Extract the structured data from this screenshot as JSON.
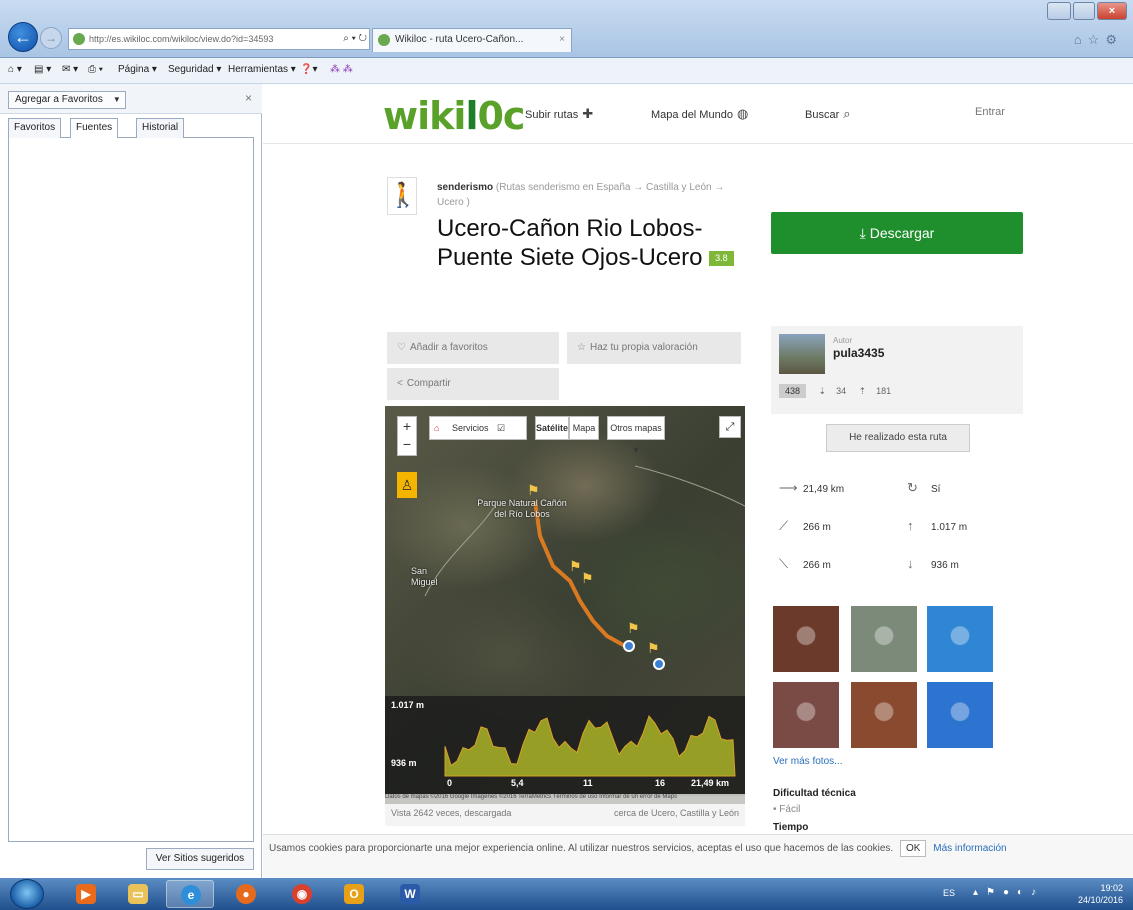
{
  "browser": {
    "url": "http://es.wikiloc.com/wikiloc/view.do?id=34593",
    "tab_title": "Wikiloc - ruta Ucero-Cañon...",
    "menu": [
      "Página ▾",
      "Seguridad ▾",
      "Herramientas ▾"
    ]
  },
  "favorites": {
    "add_label": "Agregar a Favoritos",
    "tabs": [
      "Favoritos",
      "Fuentes",
      "Historial"
    ],
    "suggested_label": "Ver Sitios sugeridos"
  },
  "site": {
    "logo_a": "wiki",
    "logo_b": "l",
    "logo_c": "0c",
    "nav": {
      "upload": "Subir rutas",
      "world_map": "Mapa del Mundo",
      "search": "Buscar",
      "login": "Entrar"
    }
  },
  "route": {
    "activity": "senderismo",
    "breadcrumb": "(Rutas senderismo en España → Castilla y León → Ucero )",
    "title": "Ucero-Cañon Rio Lobos-Puente Siete Ojos-Ucero",
    "badge": "3.8",
    "download": "Descargar",
    "actions": {
      "favorite": "Añadir a favoritos",
      "rate": "Haz tu propia valoración",
      "share": "Compartir"
    }
  },
  "map": {
    "zoom_in": "+",
    "zoom_out": "−",
    "services": "Servicios",
    "satellite": "Satélite",
    "map_type": "Mapa",
    "other_maps": "Otros mapas ▾",
    "place_1": "Parque Natural Cañón del Río Lobos",
    "place_2": "San Miguel",
    "elev_max": "1.017 m",
    "elev_min": "936 m",
    "x_ticks": [
      "0",
      "5,4",
      "11",
      "16",
      "21,49 km"
    ],
    "attribution": "Datos de mapas ©2016 Google Imágenes ©2016 TerraMetrics Términos de uso Informar de un error de Maps",
    "footer_left": "Vista 2642 veces, descargada",
    "footer_right": "cerca de Ucero, Castilla y León"
  },
  "author": {
    "label": "Autor",
    "name": "pula3435",
    "routes": "438",
    "followers": "34",
    "following": "181",
    "done_button": "He realizado esta ruta"
  },
  "stats": {
    "distance": "21,49 km",
    "loop": "Sí",
    "up": "266 m",
    "max_alt": "1.017 m",
    "down": "266 m",
    "min_alt": "936 m"
  },
  "photos": {
    "more": "Ver más fotos...",
    "colors": [
      "#6b3a2a",
      "#7c8a7a",
      "#2f86d4",
      "#7a4a45",
      "#8a4a30",
      "#2c74cf"
    ]
  },
  "details": {
    "difficulty_label": "Dificultad técnica",
    "difficulty_value": "Fácil",
    "time_label": "Tiempo"
  },
  "cookie": {
    "text": "Usamos cookies para proporcionarte una mejor experiencia online. Al utilizar nuestros servicios, aceptas el uso que hacemos de las cookies.",
    "ok": "OK",
    "more": "Más información"
  },
  "taskbar": {
    "lang": "ES",
    "time": "19:02",
    "date": "24/10/2016"
  }
}
